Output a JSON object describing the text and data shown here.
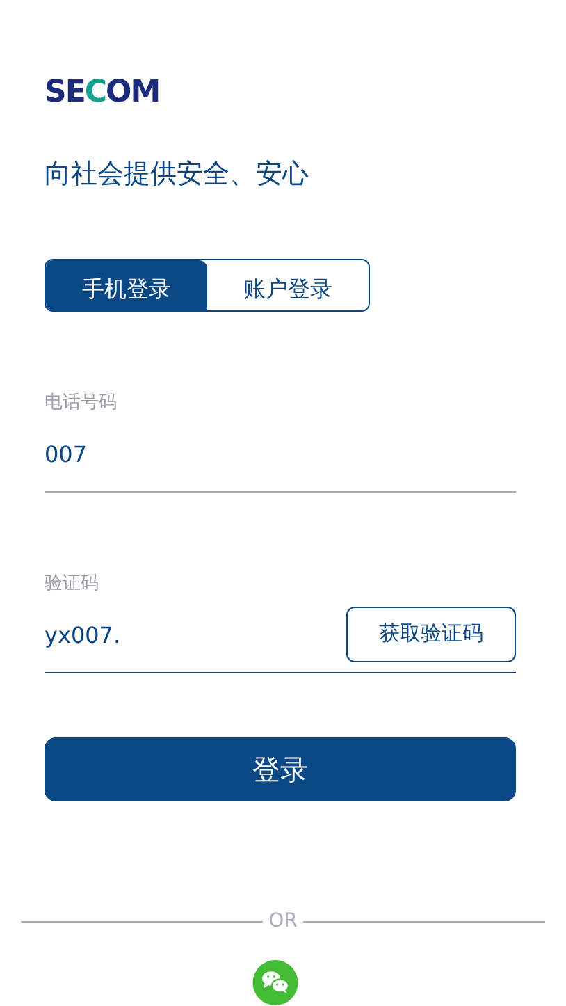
{
  "logo": {
    "text": "SECOM"
  },
  "tagline": "向社会提供安全、安心",
  "tabs": [
    {
      "label": "手机登录",
      "selected": true
    },
    {
      "label": "账户登录",
      "selected": false
    }
  ],
  "fields": [
    {
      "label": "电话号码",
      "value": "007",
      "focused": false
    },
    {
      "label": "验证码",
      "value": "yx007.",
      "focused": true,
      "button": "获取验证码"
    }
  ],
  "submit": "登录",
  "divider": "OR"
}
